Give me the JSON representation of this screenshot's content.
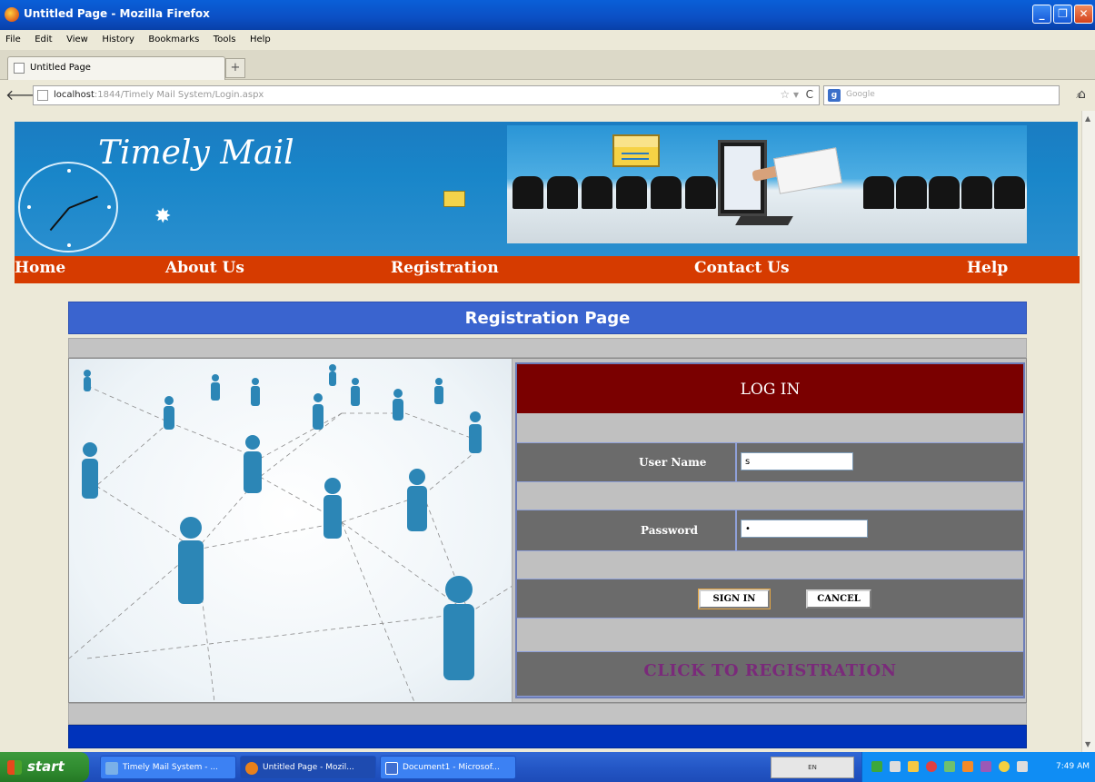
{
  "window": {
    "title": "Untitled Page - Mozilla Firefox"
  },
  "menu": [
    "File",
    "Edit",
    "View",
    "History",
    "Bookmarks",
    "Tools",
    "Help"
  ],
  "tab": {
    "label": "Untitled Page",
    "new_tab": "+"
  },
  "urlbar": {
    "host": "localhost",
    "path": ":1844/Timely Mail System/Login.aspx"
  },
  "search": {
    "placeholder": "Google"
  },
  "site": {
    "title": "Timely Mail",
    "nav": [
      "Home",
      "About Us",
      "Registration",
      "Contact Us",
      "Help"
    ]
  },
  "panel": {
    "header": "Registration Page"
  },
  "login": {
    "heading": "LOG IN",
    "username_label": "User Name",
    "username_value": "s",
    "password_label": "Password",
    "password_value": "•",
    "signin_label": "SIGN IN",
    "cancel_label": "CANCEL",
    "register_link": "CLICK TO REGISTRATION"
  },
  "taskbar": {
    "start": "start",
    "items": [
      "Timely Mail System - ...",
      "Untitled Page - Mozil...",
      "Document1 - Microsof..."
    ],
    "time": "7:49 AM"
  },
  "colors": {
    "nav_bg": "#d63b00",
    "panel_header": "#3a64cf",
    "login_head": "#7a0000",
    "register_link": "#7a2a7a",
    "footer": "#0033bb"
  }
}
